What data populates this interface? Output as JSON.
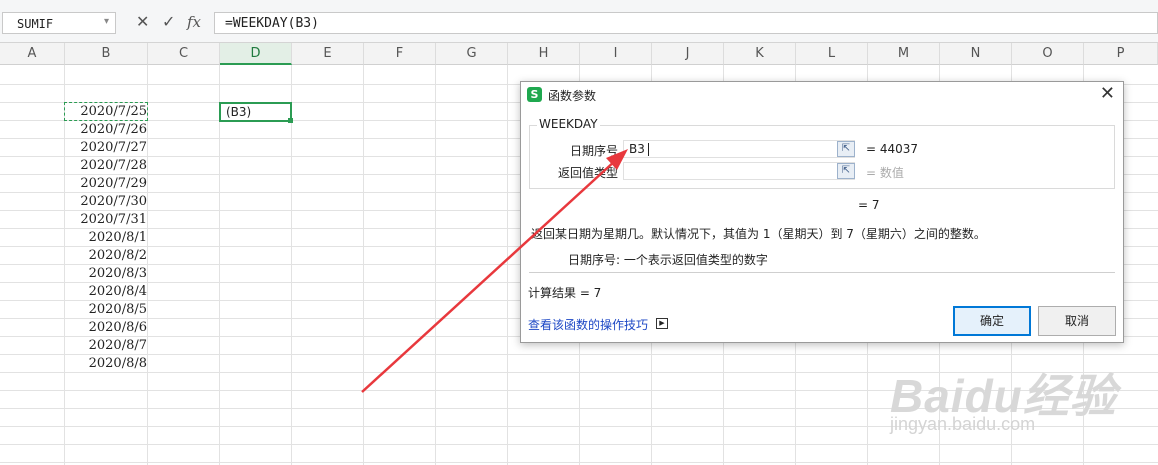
{
  "formula_bar": {
    "name_box": "SUMIF",
    "cancel_icon": "✕",
    "enter_icon": "✓",
    "fx_label": "fx",
    "formula": "=WEEKDAY(B3)"
  },
  "columns": [
    "A",
    "B",
    "C",
    "D",
    "E",
    "F",
    "G",
    "H",
    "I",
    "J",
    "K",
    "L",
    "M",
    "N",
    "O",
    "P"
  ],
  "active_column": "D",
  "column_b_values": [
    "2020/7/25",
    "2020/7/26",
    "2020/7/27",
    "2020/7/28",
    "2020/7/29",
    "2020/7/30",
    "2020/7/31",
    "2020/8/1",
    "2020/8/2",
    "2020/8/3",
    "2020/8/4",
    "2020/8/5",
    "2020/8/6",
    "2020/8/7",
    "2020/8/8"
  ],
  "active_cell_text": "(B3)",
  "dialog": {
    "title": "函数参数",
    "logo": "S",
    "close_icon": "✕",
    "function_name": "WEEKDAY",
    "args": [
      {
        "label": "日期序号",
        "value": "B3",
        "result": "= 44037"
      },
      {
        "label": "返回值类型",
        "value": "",
        "result": "= 数值"
      }
    ],
    "formula_result_line": "= 7",
    "description": "返回某日期为星期几。默认情况下，其值为 1（星期天）到 7（星期六）之间的整数。",
    "arg_help": "日期序号:   一个表示返回值类型的数字",
    "calc_result": "计算结果 = 7",
    "help_link": "查看该函数的操作技巧",
    "ok_label": "确定",
    "cancel_label": "取消"
  },
  "watermark": {
    "brand": "Baidu经验",
    "url": "jingyan.baidu.com"
  }
}
